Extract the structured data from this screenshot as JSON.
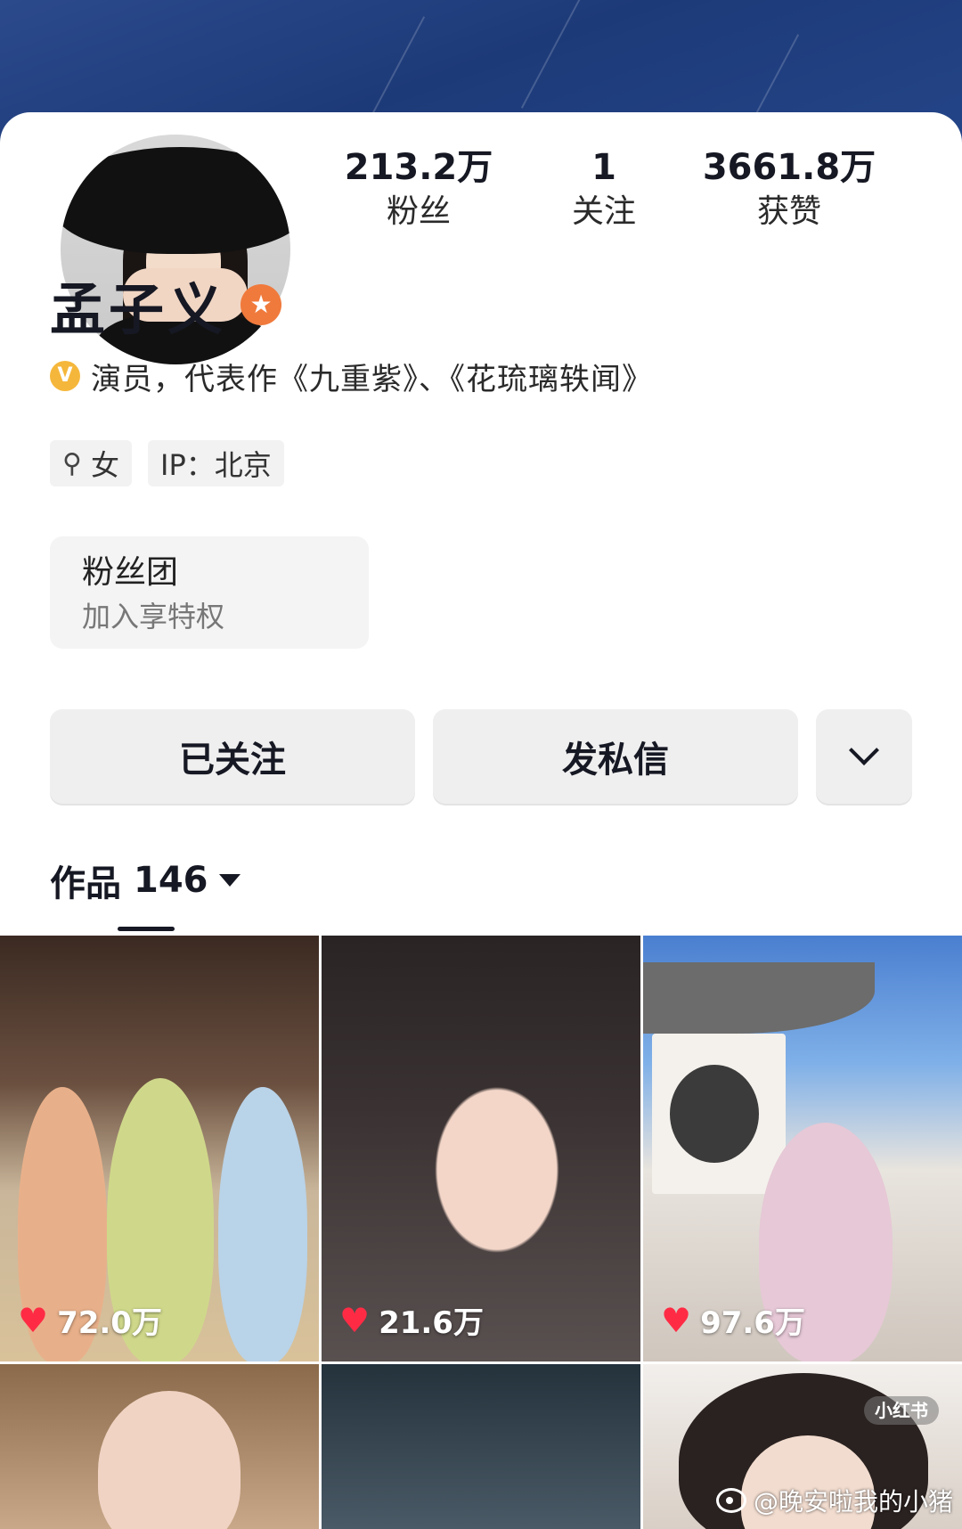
{
  "profile": {
    "name": "孟子义",
    "verification": "演员，代表作《九重紫》、《花琉璃轶闻》",
    "verified_badge": "V",
    "level_badge": "★"
  },
  "stats": [
    {
      "value": "213.2万",
      "label": "粉丝"
    },
    {
      "value": "1",
      "label": "关注"
    },
    {
      "value": "3661.8万",
      "label": "获赞"
    }
  ],
  "tags": {
    "gender_icon": "⚲",
    "gender": "女",
    "ip": "IP：北京"
  },
  "fan_club": {
    "title": "粉丝团",
    "subtitle": "加入享特权"
  },
  "actions": {
    "follow_label": "已关注",
    "message_label": "发私信"
  },
  "works": {
    "label": "作品",
    "count": "146"
  },
  "grid": [
    {
      "likes": "72.0万"
    },
    {
      "likes": "21.6万"
    },
    {
      "likes": "97.6万"
    }
  ],
  "overlay": {
    "xhs_badge": "小红书",
    "watermark": "@晚安啦我的小猪"
  },
  "colors": {
    "banner": "#24468a",
    "like_heart": "#ff2b45",
    "level_badge": "#f07a3c",
    "verified_badge": "#f5b73b"
  }
}
